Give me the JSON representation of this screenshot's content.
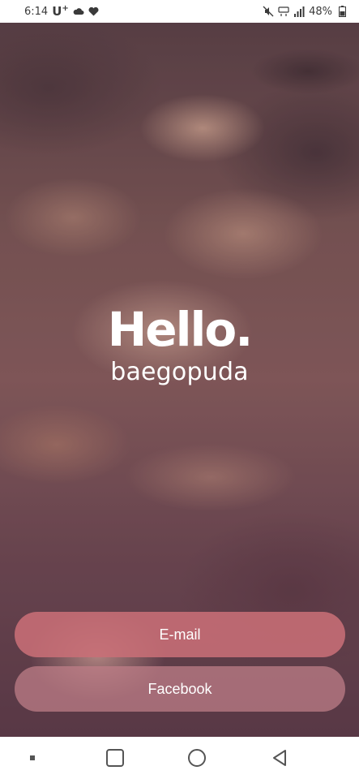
{
  "status_bar": {
    "time": "6:14",
    "carrier": "U",
    "carrier_sup": "+",
    "battery": "48%"
  },
  "hero": {
    "title": "Hello.",
    "subtitle": "baegopuda"
  },
  "buttons": {
    "email_label": "E-mail",
    "facebook_label": "Facebook"
  },
  "icons": {
    "status": [
      "cloud-icon",
      "heart-icon",
      "mute-icon",
      "volte-icon",
      "signal-icon",
      "battery-icon"
    ],
    "nav": [
      "menu-icon",
      "recent-apps-icon",
      "home-icon",
      "back-icon"
    ]
  },
  "colors": {
    "email_button": "#c86e76",
    "facebook_button": "#be7d87",
    "text": "#ffffff"
  }
}
